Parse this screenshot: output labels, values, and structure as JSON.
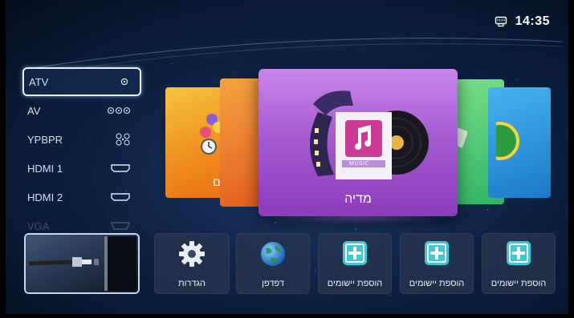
{
  "status": {
    "time": "14:35",
    "network_icon": "ethernet-icon"
  },
  "sources": [
    {
      "label": "ATV",
      "icon": "antenna-icon",
      "selected": true
    },
    {
      "label": "AV",
      "icon": "rca-jacks-icon",
      "selected": false
    },
    {
      "label": "YPBPR",
      "icon": "component-jacks-icon",
      "selected": false
    },
    {
      "label": "HDMI 1",
      "icon": "hdmi-port-icon",
      "selected": false
    },
    {
      "label": "HDMI 2",
      "icon": "hdmi-port-icon",
      "selected": false
    },
    {
      "label": "VGA",
      "icon": "vga-port-icon",
      "selected": false
    }
  ],
  "carousel": {
    "far_left_label": "ים",
    "main_label": "מדיה",
    "main_badge": "MUSIC",
    "main_color": "#a357cf"
  },
  "tiles": {
    "settings": "הגדרות",
    "browser": "דפדפן",
    "add_apps": [
      "הוספת יישומים",
      "הוספת יישומים",
      "הוספת יישומים"
    ]
  }
}
